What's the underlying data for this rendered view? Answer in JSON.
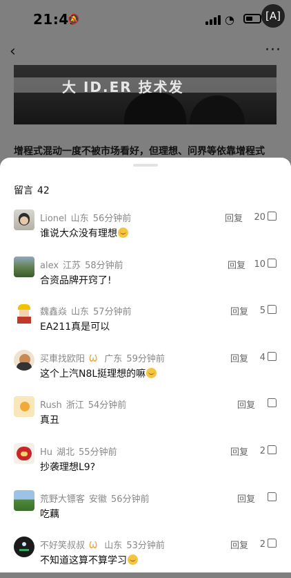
{
  "status_bar": {
    "time": "21:49"
  },
  "background": {
    "banner_text": "大 ID.ER 技术发",
    "article_line": "增程式混动一度不被市场看好，但理想、问界等依靠增程式"
  },
  "comments_sheet": {
    "title": "留言",
    "count": "42",
    "reply_label": "回复",
    "comments": [
      {
        "user": "Lionel",
        "region": "山东",
        "time": "56分钟前",
        "text": "谁说大众没有理想",
        "likes": "20",
        "emoji": "grin-emoji"
      },
      {
        "user": "alex",
        "region": "江苏",
        "time": "58分钟前",
        "text": "合资品牌开窍了!",
        "likes": "10"
      },
      {
        "user": "魏鑫焱",
        "region": "山东",
        "time": "57分钟前",
        "text": "EA211真是可以",
        "likes": "5"
      },
      {
        "user": "买車找欧阳",
        "region": "广东",
        "time": "59分钟前",
        "text": "这个上汽N8L挺理想的嘛",
        "likes": "4",
        "vip": true,
        "emoji": "cat-emoji"
      },
      {
        "user": "Rush",
        "region": "浙江",
        "time": "54分钟前",
        "text": "真丑",
        "likes": ""
      },
      {
        "user": "Hu",
        "region": "湖北",
        "time": "55分钟前",
        "text": "抄袭理想L9?",
        "likes": "2"
      },
      {
        "user": "荒野大镖客",
        "region": "安徽",
        "time": "56分钟前",
        "text": "吃藕",
        "likes": ""
      },
      {
        "user": "不好笑叔叔",
        "region": "山东",
        "time": "53分钟前",
        "text": "不知道这算不算学习",
        "likes": "2",
        "vip": true,
        "emoji": "cat-emoji"
      }
    ]
  },
  "colors": {
    "overlay": "#7f7f7f",
    "sheet": "#ffffff",
    "muted_text": "#888888",
    "vip_badge": "#e9a93a"
  }
}
